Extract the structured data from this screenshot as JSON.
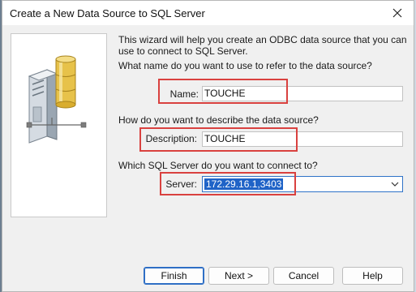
{
  "window": {
    "title": "Create a New Data Source to SQL Server"
  },
  "intro": "This wizard will help you create an ODBC data source that you can use to connect to SQL Server.",
  "name_section": {
    "question": "What name do you want to use to refer to the data source?",
    "label": "Name:",
    "value": "TOUCHE"
  },
  "description_section": {
    "question": "How do you want to describe the data source?",
    "label": "Description:",
    "value": "TOUCHE"
  },
  "server_section": {
    "question": "Which SQL Server do you want to connect to?",
    "label": "Server:",
    "value": "172.29.16.1,3403"
  },
  "buttons": {
    "finish": "Finish",
    "next": "Next >",
    "cancel": "Cancel",
    "help": "Help"
  },
  "icons": {
    "close": "close-icon",
    "dropdown": "chevron-down-icon",
    "graphic": "database-server-icon"
  },
  "colors": {
    "highlight": "#d9413f",
    "selection": "#1f63c7",
    "focus": "#2f6fc5"
  }
}
